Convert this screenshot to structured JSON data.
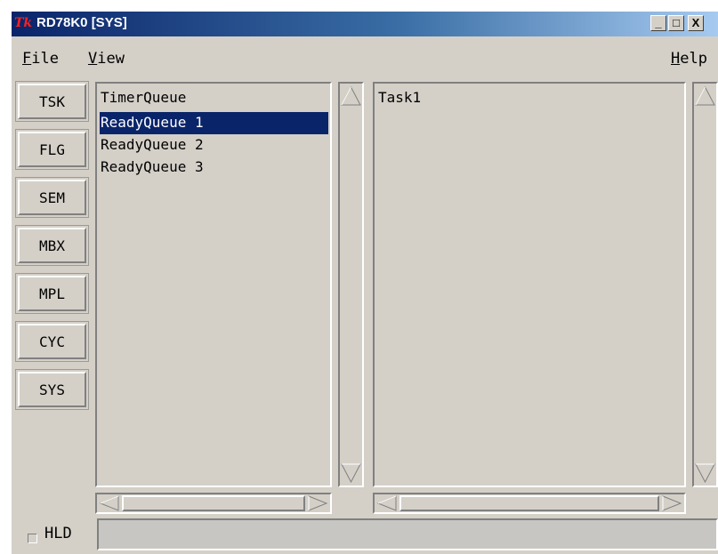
{
  "window": {
    "app_icon": "Tk",
    "title": "RD78K0 [SYS]",
    "minimize": "_",
    "maximize": "□",
    "close": "X"
  },
  "menu": {
    "file": "File",
    "view": "View",
    "help": "Help"
  },
  "sidebar": {
    "buttons": [
      "TSK",
      "FLG",
      "SEM",
      "MBX",
      "MPL",
      "CYC",
      "SYS"
    ]
  },
  "queue_list": {
    "items": [
      "TimerQueue",
      "ReadyQueue 1",
      "ReadyQueue 2",
      "ReadyQueue 3"
    ],
    "selected_index": 1
  },
  "task_list": {
    "items": [
      "Task1"
    ]
  },
  "footer": {
    "hld_label": "HLD",
    "hld_checked": false,
    "status_text": ""
  },
  "colors": {
    "face": "#d4d0c8",
    "selection": "#0a246a",
    "title_start": "#0a246a",
    "title_end": "#a6caf0"
  }
}
